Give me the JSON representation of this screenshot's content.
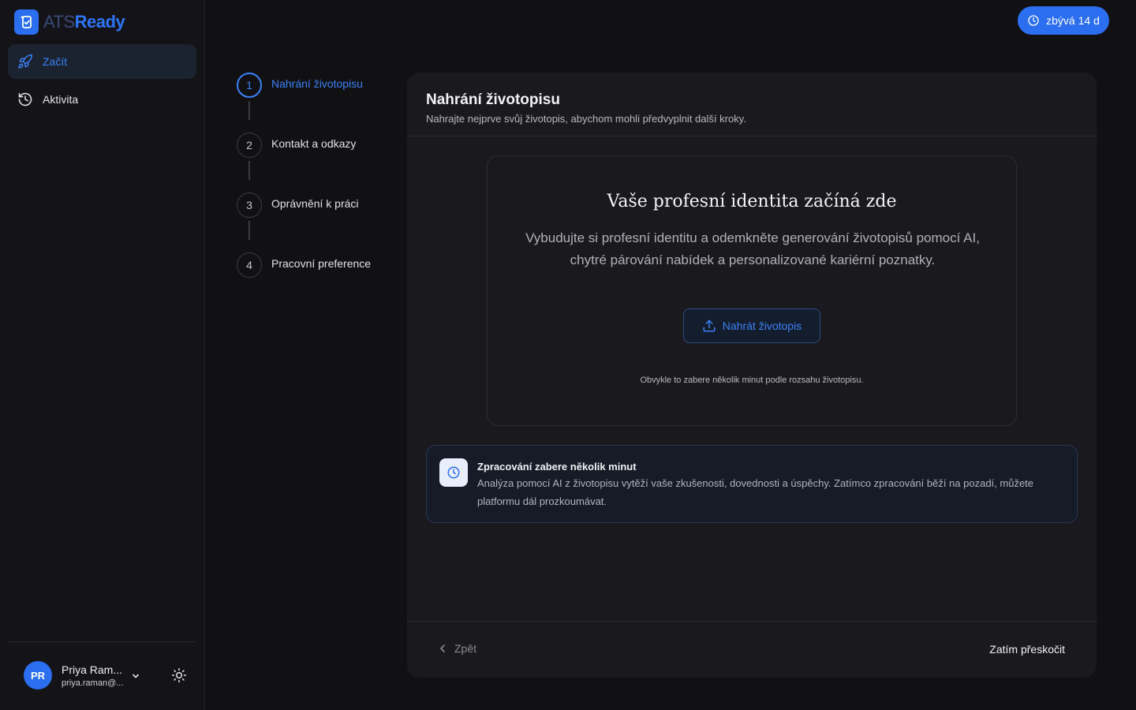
{
  "brand": {
    "name_part1": "ATS",
    "name_part2": "Ready"
  },
  "sidebar": {
    "items": [
      {
        "label": "Začít",
        "icon": "rocket-icon",
        "active": true
      },
      {
        "label": "Aktivita",
        "icon": "history-icon",
        "active": false
      }
    ]
  },
  "user": {
    "initials": "PR",
    "name": "Priya Ram...",
    "email": "priya.raman@..."
  },
  "trial": {
    "label": "zbývá 14 d"
  },
  "steps": [
    {
      "number": "1",
      "label": "Nahrání životopisu",
      "active": true
    },
    {
      "number": "2",
      "label": "Kontakt a odkazy",
      "active": false
    },
    {
      "number": "3",
      "label": "Oprávnění k práci",
      "active": false
    },
    {
      "number": "4",
      "label": "Pracovní preference",
      "active": false
    }
  ],
  "card": {
    "title": "Nahrání životopisu",
    "subtitle": "Nahrajte nejprve svůj životopis, abychom mohli předvyplnit další kroky."
  },
  "upload": {
    "heading": "Vaše profesní identita začíná zde",
    "description": "Vybudujte si profesní identitu a odemkněte generování životopisů pomocí AI, chytré párování nabídek a personalizované kariérní poznatky.",
    "button_label": "Nahrát životopis",
    "note": "Obvykle to zabere několik minut podle rozsahu životopisu."
  },
  "info": {
    "title": "Zpracování zabere několik minut",
    "text": "Analýza pomocí AI z životopisu vytěží vaše zkušenosti, dovednosti a úspěchy. Zatímco zpracování běží na pozadí, můžete platformu dál prozkoumávat."
  },
  "footer": {
    "back_label": "Zpět",
    "skip_label": "Zatím přeskočit"
  },
  "colors": {
    "accent": "#2b6ef0",
    "background": "#111114",
    "card": "#1a1a1e"
  }
}
